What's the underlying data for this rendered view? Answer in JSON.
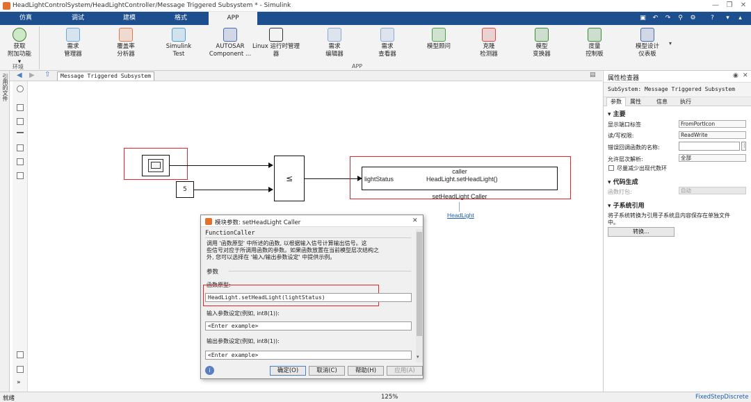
{
  "window": {
    "title": "HeadLightControlSystem/HeadLightController/Message Triggered Subsystem * - Simulink"
  },
  "tabs": [
    "仿真",
    "调试",
    "建模",
    "格式",
    "APP"
  ],
  "ribbon": {
    "left": {
      "label1": "获取",
      "label2": "附加功能 ▾",
      "group": "环境"
    },
    "buttons": [
      {
        "l1": "需求",
        "l2": "管理器",
        "icon": "requirements-icon"
      },
      {
        "l1": "覆盖率",
        "l2": "分析器",
        "icon": "coverage-icon"
      },
      {
        "l1": "Simulink",
        "l2": "Test",
        "icon": "test-icon"
      },
      {
        "l1": "AUTOSAR",
        "l2": "Component ...",
        "icon": "autosar-icon"
      },
      {
        "l1": "Linux 运行时管理",
        "l2": "器",
        "icon": "linux-runtime-icon"
      },
      {
        "l1": "需求",
        "l2": "编辑器",
        "icon": "req-editor-icon"
      },
      {
        "l1": "需求",
        "l2": "查看器",
        "icon": "req-viewer-icon"
      },
      {
        "l1": "模型顾问",
        "l2": "",
        "icon": "model-advisor-icon"
      },
      {
        "l1": "克隆",
        "l2": "检测器",
        "icon": "clone-detector-icon"
      },
      {
        "l1": "模型",
        "l2": "变换器",
        "icon": "model-transformer-icon"
      },
      {
        "l1": "度量",
        "l2": "控制板",
        "icon": "metrics-dashboard-icon"
      },
      {
        "l1": "模型设计",
        "l2": "仪表板",
        "icon": "design-dashboard-icon"
      }
    ],
    "group": "APP"
  },
  "breadcrumb": "Message Triggered Subsystem",
  "side_tab": "引用的文件",
  "diagram": {
    "const_value": "5",
    "relop": "≤",
    "caller_title": "caller",
    "caller_in": "lightStatus",
    "caller_func": "HeadLight.setHeadLight()",
    "caller_name": "setHeadLight Caller",
    "link": "HeadLight"
  },
  "inspector": {
    "title": "属性检查器",
    "subsystem": "SubSystem: Message Triggered Subsystem",
    "tabs": [
      "参数",
      "属性",
      "信息",
      "执行"
    ],
    "main_header": "▾ 主要",
    "rows": [
      {
        "label": "显示端口标签",
        "value": "FromPortIcon"
      },
      {
        "label": "读/写权限:",
        "value": "ReadWrite"
      },
      {
        "label": "错误回调函数的名称:",
        "value": ""
      },
      {
        "label": "允许层次解析:",
        "value": "全部"
      }
    ],
    "checkbox": "尽量减少出现代数环",
    "codegen_header": "▾ 代码生成",
    "pkg_label": "函数打包:",
    "pkg_value": "自动",
    "ref_header": "▾ 子系统引用",
    "ref_text1": "将子系统转换为引用子系统且内容保存在单独文件",
    "ref_text2": "中。",
    "convert_btn": "转换..."
  },
  "dialog": {
    "title": "模块参数: setHeadLight Caller",
    "section": "FunctionCaller",
    "desc1": "调用 '函数原型' 中所述的函数, 以根据输入信号计算输出信号。这",
    "desc2": "些信号对应于所调用函数的参数。如果函数放置在当前模型层次结构之",
    "desc3": "外, 您可以选择在 '输入/输出参数设定' 中提供示例。",
    "params": "参数",
    "proto_label": "函数原型:",
    "proto_value": "HeadLight.setHeadLight(lightStatus)",
    "in_label": "输入参数设定(例如, int8(1)):",
    "in_value": "<Enter example>",
    "out_label": "输出参数设定(例如, int8(1)):",
    "out_value": "<Enter example>",
    "ok": "确定(O)",
    "cancel": "取消(C)",
    "help": "帮助(H)",
    "apply": "应用(A)"
  },
  "status": {
    "left": "就绪",
    "zoom": "125%",
    "solver": "FixedStepDiscrete"
  },
  "colors": {
    "tabbar": "#1d4f8e",
    "highlight": "#e0252b",
    "link": "#1a5fb4"
  }
}
